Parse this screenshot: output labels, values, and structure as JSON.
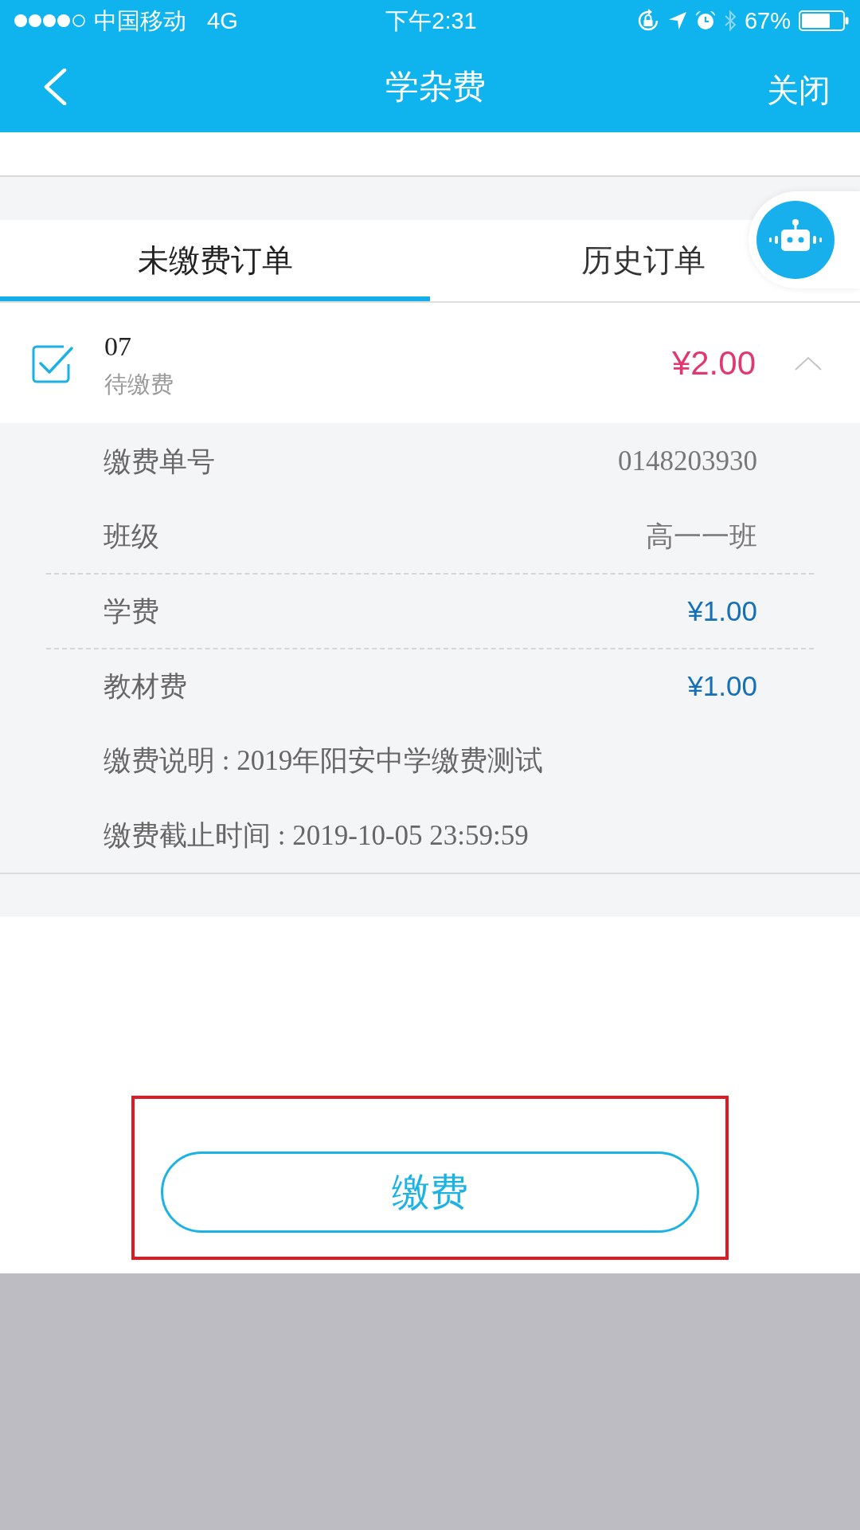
{
  "status_bar": {
    "carrier": "中国移动",
    "network": "4G",
    "time": "下午2:31",
    "battery": "67%"
  },
  "header": {
    "title": "学杂费",
    "close": "关闭"
  },
  "tabs": [
    {
      "label": "未缴费订单",
      "selected": true
    },
    {
      "label": "历史订单",
      "selected": false
    }
  ],
  "order": {
    "checked": true,
    "number": "07",
    "status": "待缴费",
    "amount": "¥2.00",
    "expanded": true,
    "details": [
      {
        "kind": "plain",
        "label": "缴费单号",
        "value": "0148203930"
      },
      {
        "kind": "plain",
        "label": "班级",
        "value": "高一一班"
      },
      {
        "kind": "fee",
        "label": "学费",
        "value": "¥1.00"
      },
      {
        "kind": "fee",
        "label": "教材费",
        "value": "¥1.00"
      }
    ],
    "notes": [
      "缴费说明 : 2019年阳安中学缴费测试",
      "缴费截止时间 : 2019-10-05 23:59:59"
    ]
  },
  "pay_button": {
    "label": "缴费",
    "highlighted": true
  }
}
